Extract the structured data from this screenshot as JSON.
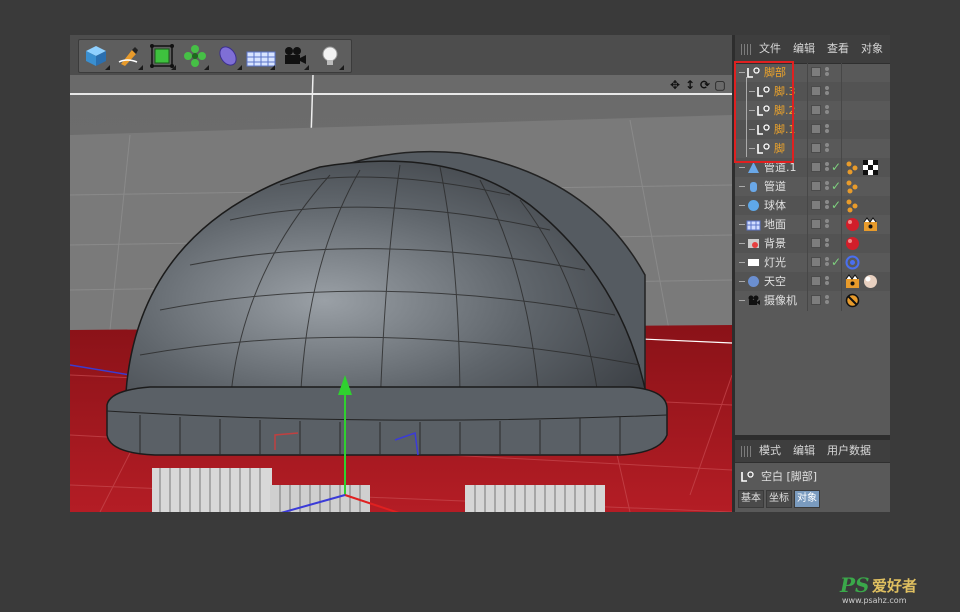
{
  "toolbar": {
    "tools": [
      {
        "icon": "cube-icon",
        "color": "#4aa8e8"
      },
      {
        "icon": "pen-spline-icon",
        "color": "#e8a030"
      },
      {
        "icon": "subdivision-cube-icon",
        "color": "#42c442"
      },
      {
        "icon": "cloner-array-icon",
        "color": "#46c046"
      },
      {
        "icon": "deformer-bend-icon",
        "color": "#7f6fd6"
      },
      {
        "icon": "floor-grid-icon",
        "color": "#6f8fd8"
      },
      {
        "icon": "camera-icon",
        "color": "#222222"
      },
      {
        "icon": "light-bulb-icon",
        "color": "#f0f0f0"
      }
    ]
  },
  "viewport": {
    "nav_icons": [
      "move-view-icon",
      "dolly-view-icon",
      "rotate-view-icon",
      "maximize-view-icon"
    ]
  },
  "object_manager": {
    "menu": [
      "文件",
      "编辑",
      "查看",
      "对象"
    ],
    "items": [
      {
        "label": "脚部",
        "icon": "null-icon",
        "color": "#f0a52a",
        "selected": true,
        "check": false,
        "tags": []
      },
      {
        "label": "脚.3",
        "icon": "null-icon",
        "color": "#f0a52a",
        "selected": true,
        "check": false,
        "tags": []
      },
      {
        "label": "脚.2",
        "icon": "null-icon",
        "color": "#f0a52a",
        "selected": true,
        "check": false,
        "tags": []
      },
      {
        "label": "脚.1",
        "icon": "null-icon",
        "color": "#f0a52a",
        "selected": true,
        "check": false,
        "tags": []
      },
      {
        "label": "脚",
        "icon": "null-icon",
        "color": "#f0a52a",
        "selected": true,
        "check": false,
        "tags": []
      },
      {
        "label": "管道.1",
        "icon": "cone-icon",
        "color": "#e0e0e0",
        "selected": false,
        "check": true,
        "tags": [
          "texture-dots-tag-icon",
          "checker-tag-icon"
        ]
      },
      {
        "label": "管道",
        "icon": "tube-icon",
        "color": "#e0e0e0",
        "selected": false,
        "check": true,
        "tags": [
          "texture-dots-tag-icon"
        ]
      },
      {
        "label": "球体",
        "icon": "sphere-icon",
        "color": "#e0e0e0",
        "selected": false,
        "check": true,
        "tags": [
          "texture-dots-tag-icon"
        ]
      },
      {
        "label": "地面",
        "icon": "floor-icon",
        "color": "#e0e0e0",
        "selected": false,
        "check": false,
        "tags": [
          "red-material-tag-icon",
          "compositing-tag-icon"
        ]
      },
      {
        "label": "背景",
        "icon": "background-icon",
        "color": "#e0e0e0",
        "selected": false,
        "check": false,
        "tags": [
          "red-material-tag-icon"
        ]
      },
      {
        "label": "灯光",
        "icon": "light-icon",
        "color": "#e0e0e0",
        "selected": false,
        "check": true,
        "tags": [
          "target-tag-icon"
        ]
      },
      {
        "label": "天空",
        "icon": "sky-icon",
        "color": "#e0e0e0",
        "selected": false,
        "check": false,
        "tags": [
          "compositing-tag-icon",
          "hdri-material-tag-icon"
        ]
      },
      {
        "label": "摄像机",
        "icon": "camera-icon",
        "color": "#e0e0e0",
        "selected": false,
        "check": false,
        "tags": [
          "protection-tag-icon"
        ]
      }
    ]
  },
  "attributes": {
    "menu": [
      "模式",
      "编辑",
      "用户数据"
    ],
    "object_title": "空白 [脚部]",
    "tabs": [
      "基本",
      "坐标",
      "对象"
    ],
    "active_tab": "对象"
  },
  "watermark": {
    "brand": "PS",
    "chinese": "爱好者",
    "url": "www.psahz.com"
  }
}
